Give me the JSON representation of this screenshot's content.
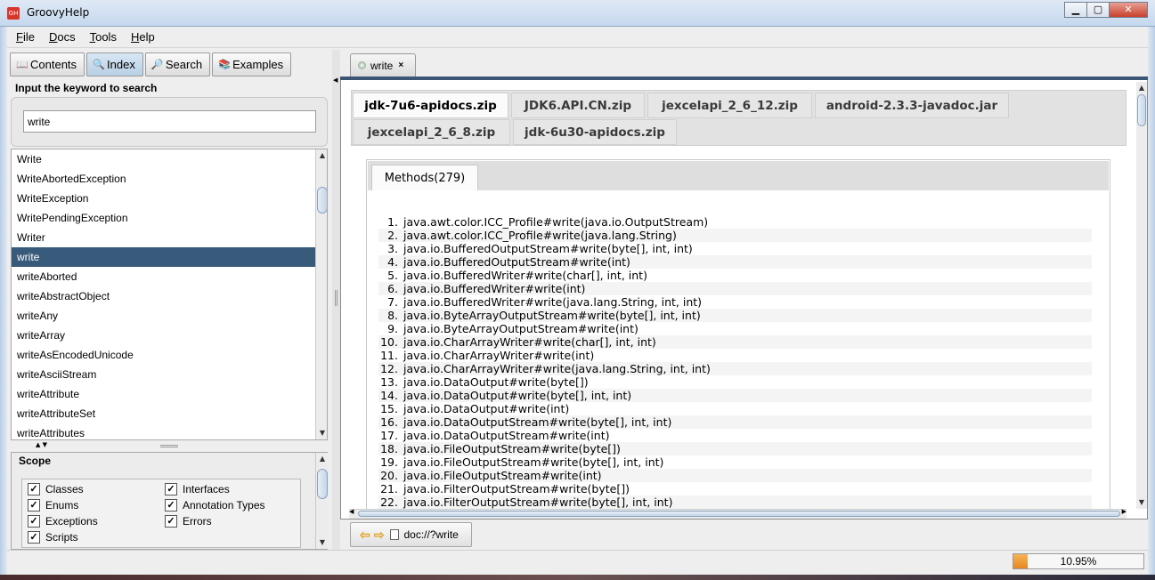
{
  "window": {
    "title": "GroovyHelp",
    "icon_text": "GH",
    "min": "▁",
    "max": "▢",
    "close": "✕"
  },
  "menu": [
    {
      "mnemonic": "F",
      "rest": "ile"
    },
    {
      "mnemonic": "D",
      "rest": "ocs"
    },
    {
      "mnemonic": "T",
      "rest": "ools"
    },
    {
      "mnemonic": "H",
      "rest": "elp"
    }
  ],
  "left_tabs": [
    {
      "label": "Contents",
      "icon": "book-icon",
      "active": false
    },
    {
      "label": "Index",
      "icon": "magnifier-icon",
      "active": true
    },
    {
      "label": "Search",
      "icon": "search-doc-icon",
      "active": false
    },
    {
      "label": "Examples",
      "icon": "examples-icon",
      "active": false
    }
  ],
  "keyword": {
    "label": "Input the keyword to search",
    "value": "write"
  },
  "index_list": [
    "Write",
    "WriteAbortedException",
    "WriteException",
    "WritePendingException",
    "Writer",
    "write",
    "writeAborted",
    "writeAbstractObject",
    "writeAny",
    "writeArray",
    "writeAsEncodedUnicode",
    "writeAsciiStream",
    "writeAttribute",
    "writeAttributeSet",
    "writeAttributes"
  ],
  "index_selected": 5,
  "scope": {
    "title": "Scope",
    "items": [
      {
        "label": "Classes",
        "checked": true
      },
      {
        "label": "Interfaces",
        "checked": true
      },
      {
        "label": "Enums",
        "checked": true
      },
      {
        "label": "Annotation Types",
        "checked": true
      },
      {
        "label": "Exceptions",
        "checked": true
      },
      {
        "label": "Errors",
        "checked": true
      },
      {
        "label": "Scripts",
        "checked": true
      }
    ]
  },
  "doc_tab": {
    "label": "write",
    "close": "×"
  },
  "zip_tabs": [
    "jdk-7u6-apidocs.zip",
    "JDK6.API.CN.zip",
    "jexcelapi_2_6_12.zip",
    "android-2.3.3-javadoc.jar",
    "jexcelapi_2_6_8.zip",
    "jdk-6u30-apidocs.zip"
  ],
  "zip_active": 0,
  "methods_tab": "Methods(279)",
  "methods": [
    "java.awt.color.ICC_Profile#write(java.io.OutputStream)",
    "java.awt.color.ICC_Profile#write(java.lang.String)",
    "java.io.BufferedOutputStream#write(byte[], int, int)",
    "java.io.BufferedOutputStream#write(int)",
    "java.io.BufferedWriter#write(char[], int, int)",
    "java.io.BufferedWriter#write(int)",
    "java.io.BufferedWriter#write(java.lang.String, int, int)",
    "java.io.ByteArrayOutputStream#write(byte[], int, int)",
    "java.io.ByteArrayOutputStream#write(int)",
    "java.io.CharArrayWriter#write(char[], int, int)",
    "java.io.CharArrayWriter#write(int)",
    "java.io.CharArrayWriter#write(java.lang.String, int, int)",
    "java.io.DataOutput#write(byte[])",
    "java.io.DataOutput#write(byte[], int, int)",
    "java.io.DataOutput#write(int)",
    "java.io.DataOutputStream#write(byte[], int, int)",
    "java.io.DataOutputStream#write(int)",
    "java.io.FileOutputStream#write(byte[])",
    "java.io.FileOutputStream#write(byte[], int, int)",
    "java.io.FileOutputStream#write(int)",
    "java.io.FilterOutputStream#write(byte[])",
    "java.io.FilterOutputStream#write(byte[], int, int)"
  ],
  "nav": {
    "back": "⇦",
    "forward": "⇨",
    "url": "doc://?write"
  },
  "status": {
    "progress_text": "10.95%",
    "progress": 0.1095
  }
}
